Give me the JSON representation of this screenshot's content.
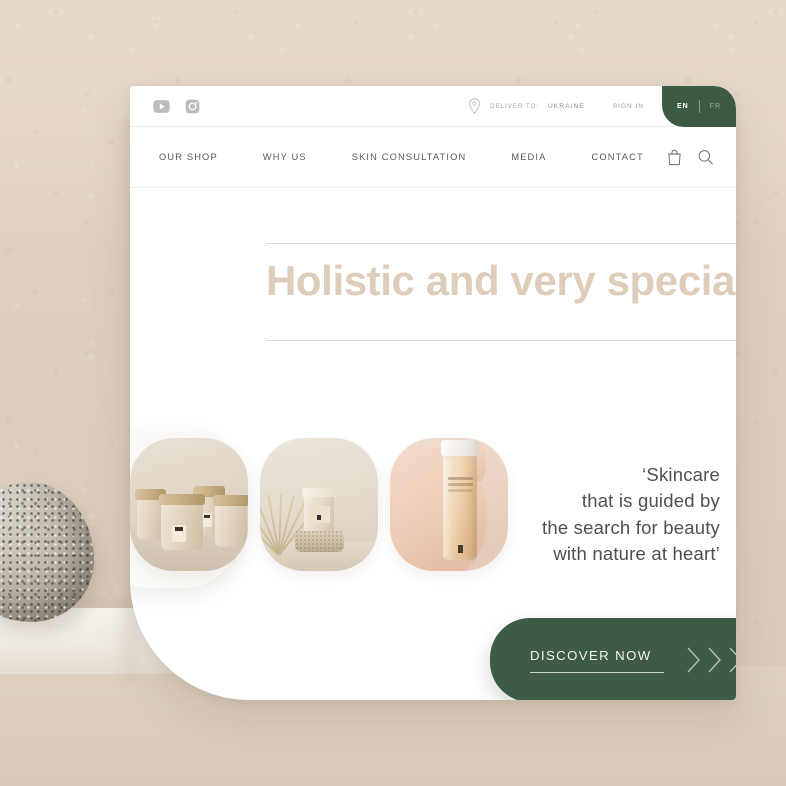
{
  "scene": {
    "background_color": "#e2d5c6",
    "shelf_color": "#d9cbba",
    "decor": {
      "stone": "speckled-granite-stone",
      "plinth": "white-plinth-shelf"
    }
  },
  "site": {
    "card_background": "#ffffff",
    "accent_green": "#3d5b45",
    "headline_color": "#ddcdba",
    "topbar": {
      "social": [
        {
          "name": "youtube-icon",
          "label": "YouTube"
        },
        {
          "name": "instagram-icon",
          "label": "Instagram"
        }
      ],
      "location_icon": "map-pin-icon",
      "deliver_label": "DELIVER TO:",
      "deliver_country": "UKRAINE",
      "sign_in": "SIGN IN",
      "languages": [
        {
          "code": "EN",
          "active": true
        },
        {
          "code": "FR",
          "active": false
        }
      ]
    },
    "nav": {
      "links": [
        {
          "label": "OUR SHOP"
        },
        {
          "label": "WHY US"
        },
        {
          "label": "SKIN CONSULTATION"
        },
        {
          "label": "MEDIA"
        },
        {
          "label": "CONTACT"
        }
      ],
      "icons": [
        {
          "name": "shopping-bag-icon",
          "label": "Cart"
        },
        {
          "name": "search-icon",
          "label": "Search"
        }
      ]
    },
    "hero": {
      "headline": "Holistic and very special"
    },
    "products": [
      {
        "name": "product-card-cream-jars",
        "alt": "Trio of frosted cream jars with wooden lids"
      },
      {
        "name": "product-card-jar-on-stone",
        "alt": "Cream jar on travertine stone with dried pampas"
      },
      {
        "name": "product-card-serum-bottle",
        "alt": "Hand holding amber serum bottle"
      }
    ],
    "quote": {
      "line1": "‘Skincare",
      "line2": "that is guided by",
      "line3": "the search for beauty",
      "line4": "with nature at heart’"
    },
    "cta": {
      "label": "DISCOVER NOW",
      "chevron_count": 3
    }
  }
}
